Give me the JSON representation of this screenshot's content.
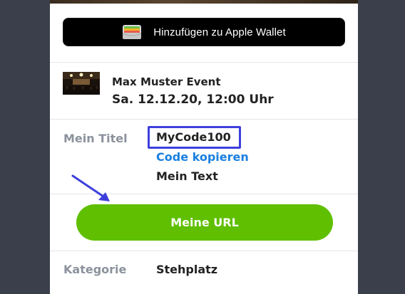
{
  "wallet": {
    "label": "Hinzufügen zu Apple Wallet",
    "icon": "wallet-icon"
  },
  "event": {
    "name": "Max Muster Event",
    "date": "Sa. 12.12.20, 12:00 Uhr"
  },
  "title_field": {
    "label": "Mein Titel",
    "code": "MyCode100",
    "copy_link": "Code kopieren",
    "text": "Mein Text"
  },
  "url_button": {
    "label": "Meine URL"
  },
  "category_field": {
    "label": "Kategorie",
    "value": "Stehplatz"
  },
  "colors": {
    "accent_green": "#5fbf00",
    "link_blue": "#1a7fe0",
    "highlight_box": "#3d3fdc",
    "annotation_arrow": "#3d3fdc"
  }
}
